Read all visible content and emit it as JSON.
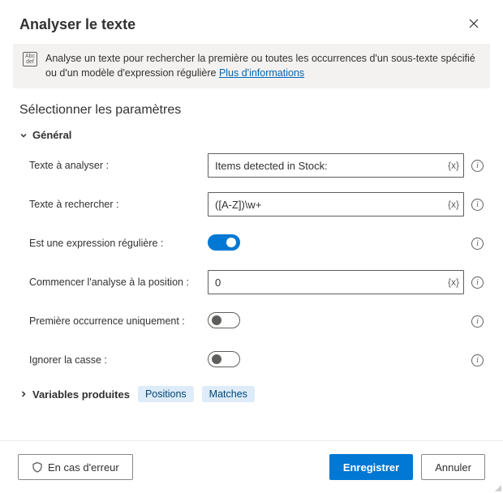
{
  "header": {
    "title": "Analyser le texte"
  },
  "banner": {
    "text_prefix": "Analyse un texte pour rechercher la première ou toutes les occurrences d'un sous-texte spécifié ou d'un modèle d'expression régulière ",
    "link_text": "Plus d'informations"
  },
  "sections": {
    "parameters_title": "Sélectionner les paramètres",
    "general": {
      "label": "Général",
      "fields": {
        "text_to_parse": {
          "label": "Texte à analyser :",
          "value": "Items detected in Stock:",
          "token": "{x}"
        },
        "text_to_find": {
          "label": "Texte à rechercher :",
          "value": "([A-Z])\\w+",
          "token": "{x}"
        },
        "is_regex": {
          "label": "Est une expression régulière :",
          "on": true
        },
        "start_position": {
          "label": "Commencer l'analyse à la position :",
          "value": "0",
          "token": "{x}"
        },
        "first_only": {
          "label": "Première occurrence uniquement :",
          "on": false
        },
        "ignore_case": {
          "label": "Ignorer la casse :",
          "on": false
        }
      }
    },
    "variables": {
      "label": "Variables produites",
      "chips": [
        "Positions",
        "Matches"
      ]
    }
  },
  "footer": {
    "on_error": "En cas d'erreur",
    "save": "Enregistrer",
    "cancel": "Annuler"
  }
}
